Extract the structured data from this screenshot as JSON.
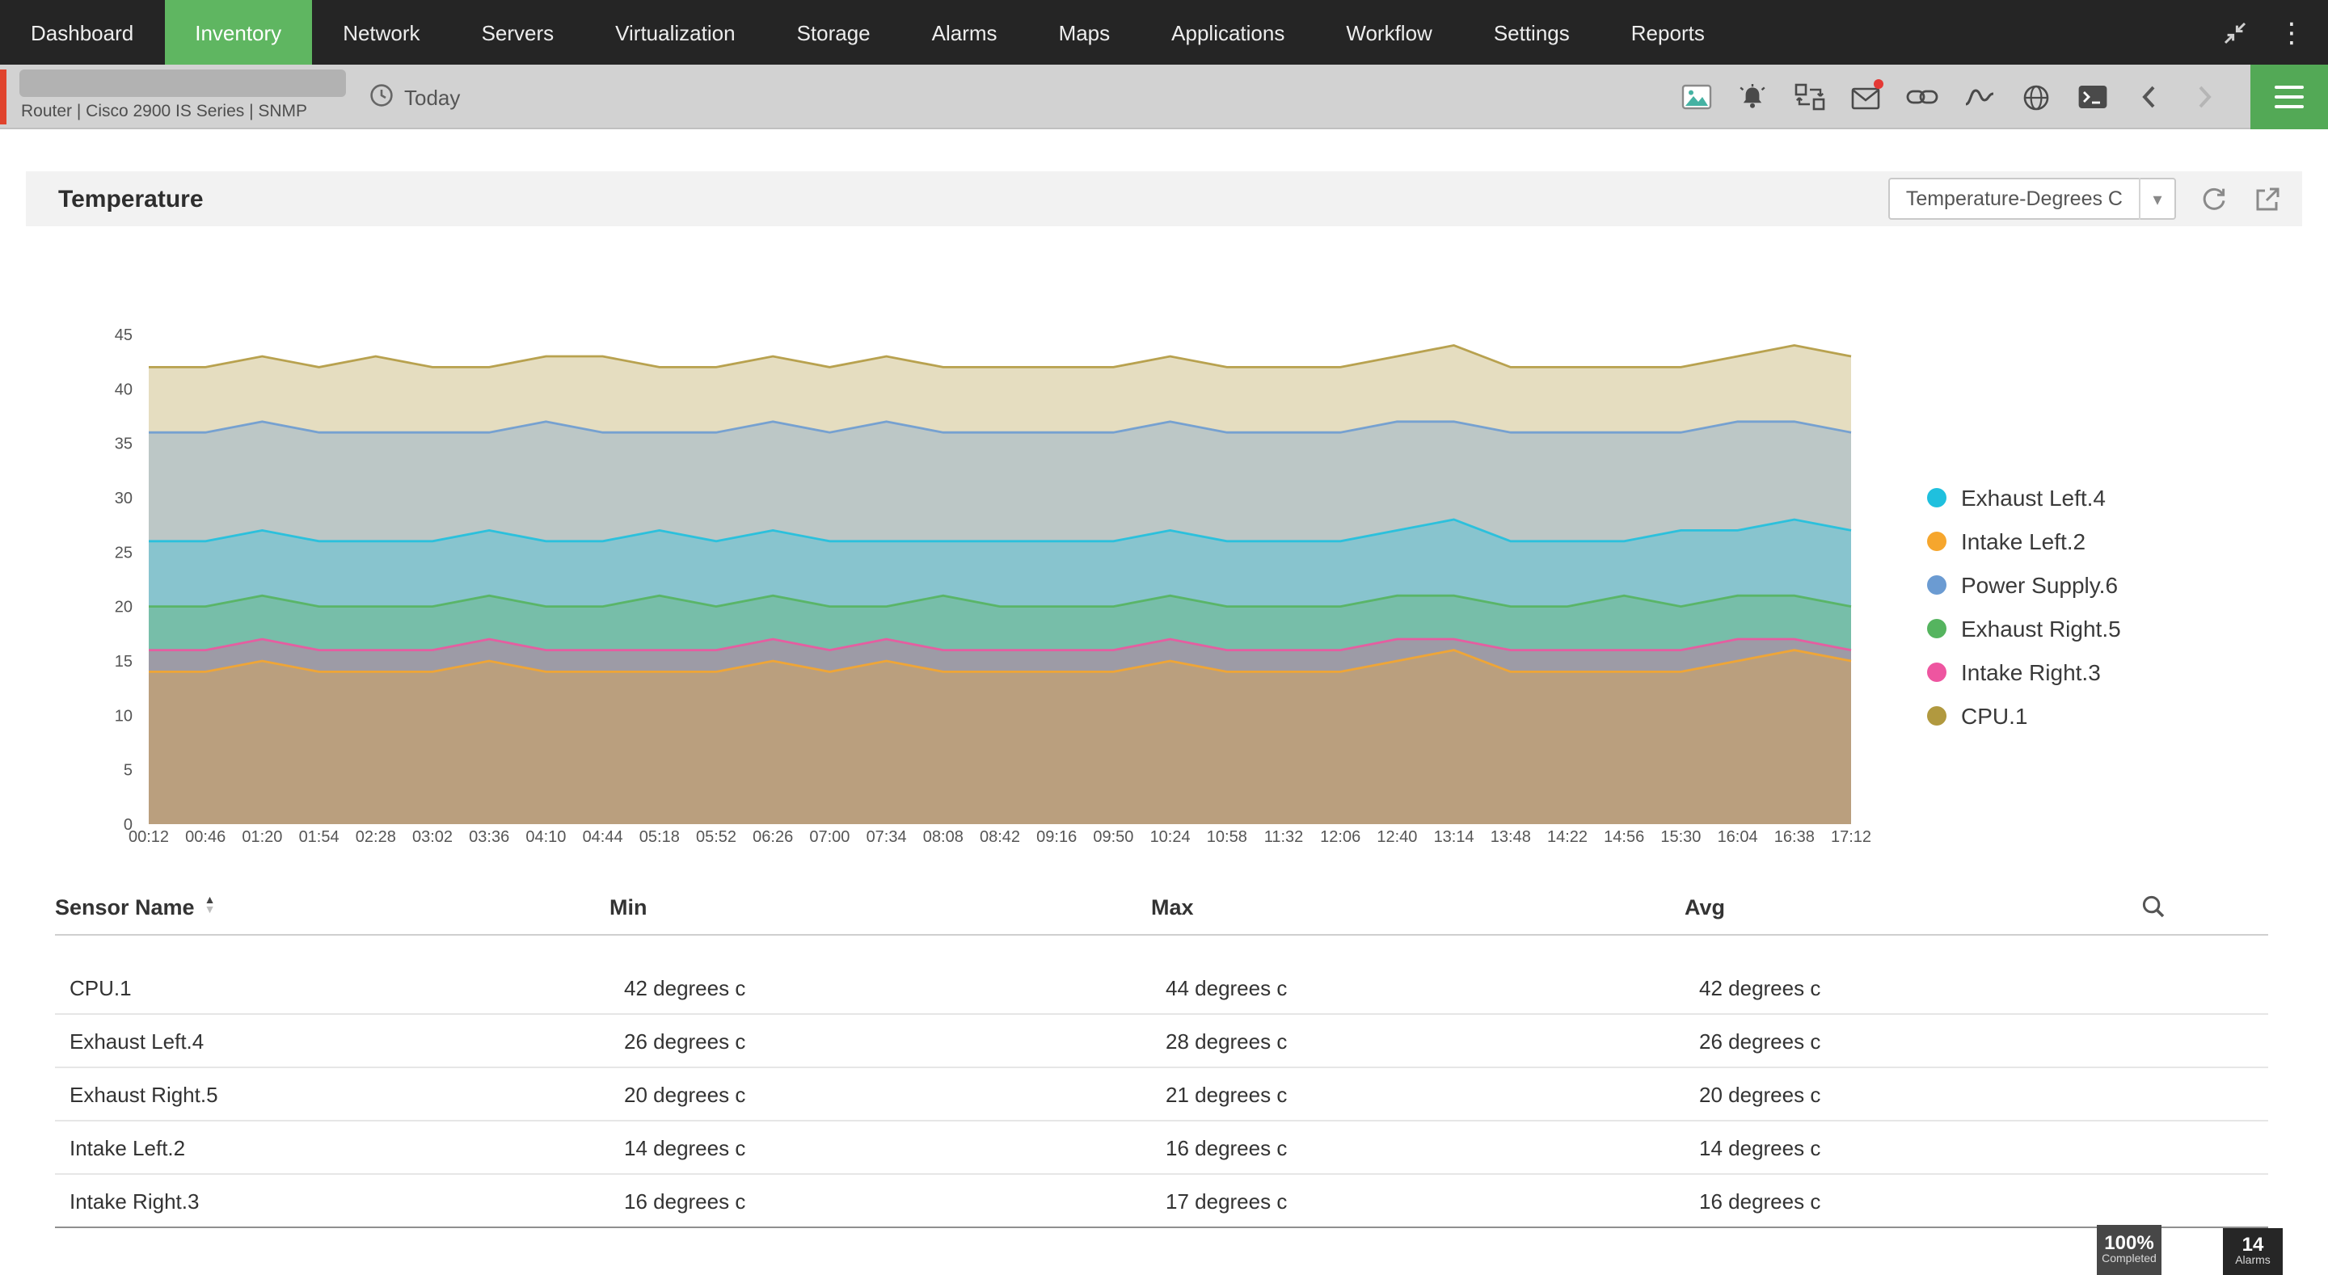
{
  "nav": {
    "items": [
      {
        "label": "Dashboard",
        "active": false
      },
      {
        "label": "Inventory",
        "active": true
      },
      {
        "label": "Network",
        "active": false
      },
      {
        "label": "Servers",
        "active": false
      },
      {
        "label": "Virtualization",
        "active": false
      },
      {
        "label": "Storage",
        "active": false
      },
      {
        "label": "Alarms",
        "active": false
      },
      {
        "label": "Maps",
        "active": false
      },
      {
        "label": "Applications",
        "active": false
      },
      {
        "label": "Workflow",
        "active": false
      },
      {
        "label": "Settings",
        "active": false
      },
      {
        "label": "Reports",
        "active": false
      }
    ],
    "right_icons": [
      "collapse-icon",
      "kebab-menu-icon"
    ],
    "kebab_glyph": "⋮"
  },
  "toolbar": {
    "device_subtitle": "Router | Cisco 2900 IS Series  | SNMP",
    "time_range_label": "Today",
    "icons": [
      "clock-icon",
      "image-icon",
      "alarm-bell-icon",
      "mapping-icon",
      "mail-icon",
      "link-icon",
      "sparkline-icon",
      "globe-icon",
      "terminal-icon",
      "chevron-left-icon",
      "chevron-right-icon",
      "hamburger-menu-icon"
    ]
  },
  "panel": {
    "title": "Temperature",
    "dropdown_value": "Temperature-Degrees C",
    "icons": [
      "refresh-icon",
      "export-icon"
    ],
    "caret_glyph": "▾"
  },
  "chart_data": {
    "type": "area",
    "title": "Temperature",
    "xlabel": "",
    "ylabel": "",
    "ylim": [
      0,
      45
    ],
    "yticks": [
      0,
      5,
      10,
      15,
      20,
      25,
      30,
      35,
      40,
      45
    ],
    "grid": false,
    "legend_position": "right",
    "x": [
      "00:12",
      "00:46",
      "01:20",
      "01:54",
      "02:28",
      "03:02",
      "03:36",
      "04:10",
      "04:44",
      "05:18",
      "05:52",
      "06:26",
      "07:00",
      "07:34",
      "08:08",
      "08:42",
      "09:16",
      "09:50",
      "10:24",
      "10:58",
      "11:32",
      "12:06",
      "12:40",
      "13:14",
      "13:48",
      "14:22",
      "14:56",
      "15:30",
      "16:04",
      "16:38",
      "17:12"
    ],
    "series": [
      {
        "name": "CPU.1",
        "color": "#b1993f",
        "values": [
          42,
          42,
          43,
          42,
          43,
          42,
          42,
          43,
          43,
          42,
          42,
          43,
          42,
          43,
          42,
          42,
          42,
          42,
          43,
          42,
          42,
          42,
          43,
          44,
          42,
          42,
          42,
          42,
          43,
          44,
          43
        ]
      },
      {
        "name": "Power Supply.6",
        "color": "#6b9bd2",
        "values": [
          36,
          36,
          37,
          36,
          36,
          36,
          36,
          37,
          36,
          36,
          36,
          37,
          36,
          37,
          36,
          36,
          36,
          36,
          37,
          36,
          36,
          36,
          37,
          37,
          36,
          36,
          36,
          36,
          37,
          37,
          36
        ]
      },
      {
        "name": "Exhaust Left.4",
        "color": "#1fc0de",
        "values": [
          26,
          26,
          27,
          26,
          26,
          26,
          27,
          26,
          26,
          27,
          26,
          27,
          26,
          26,
          26,
          26,
          26,
          26,
          27,
          26,
          26,
          26,
          27,
          28,
          26,
          26,
          26,
          27,
          27,
          28,
          27
        ]
      },
      {
        "name": "Exhaust Right.5",
        "color": "#55b45f",
        "values": [
          20,
          20,
          21,
          20,
          20,
          20,
          21,
          20,
          20,
          21,
          20,
          21,
          20,
          20,
          21,
          20,
          20,
          20,
          21,
          20,
          20,
          20,
          21,
          21,
          20,
          20,
          21,
          20,
          21,
          21,
          20
        ]
      },
      {
        "name": "Intake Right.3",
        "color": "#ee55a0",
        "values": [
          16,
          16,
          17,
          16,
          16,
          16,
          17,
          16,
          16,
          16,
          16,
          17,
          16,
          17,
          16,
          16,
          16,
          16,
          17,
          16,
          16,
          16,
          17,
          17,
          16,
          16,
          16,
          16,
          17,
          17,
          16
        ]
      },
      {
        "name": "Intake Left.2",
        "color": "#f6a62d",
        "values": [
          14,
          14,
          15,
          14,
          14,
          14,
          15,
          14,
          14,
          14,
          14,
          15,
          14,
          15,
          14,
          14,
          14,
          14,
          15,
          14,
          14,
          14,
          15,
          16,
          14,
          14,
          14,
          14,
          15,
          16,
          15
        ]
      }
    ],
    "legend": [
      "Exhaust Left.4",
      "Intake Left.2",
      "Power Supply.6",
      "Exhaust Right.5",
      "Intake Right.3",
      "CPU.1"
    ]
  },
  "table": {
    "columns": [
      "Sensor Name",
      "Min",
      "Max",
      "Avg"
    ],
    "rows": [
      {
        "name": "CPU.1",
        "min": "42 degrees c",
        "max": "44 degrees c",
        "avg": "42 degrees c"
      },
      {
        "name": "Exhaust Left.4",
        "min": "26 degrees c",
        "max": "28 degrees c",
        "avg": "26 degrees c"
      },
      {
        "name": "Exhaust Right.5",
        "min": "20 degrees c",
        "max": "21 degrees c",
        "avg": "20 degrees c"
      },
      {
        "name": "Intake Left.2",
        "min": "14 degrees c",
        "max": "16 degrees c",
        "avg": "14 degrees c"
      },
      {
        "name": "Intake Right.3",
        "min": "16 degrees c",
        "max": "17 degrees c",
        "avg": "16 degrees c"
      }
    ]
  },
  "badges": [
    {
      "value": "100%",
      "label": "Completed"
    },
    {
      "value": "14",
      "label": "Alarms"
    }
  ],
  "colors": {
    "nav_bg": "#252525",
    "active_green": "#5fb661",
    "toolbar_bg": "#d2d2d2",
    "severity_red": "#e0432d",
    "panel_header_bg": "#f2f2f2"
  }
}
